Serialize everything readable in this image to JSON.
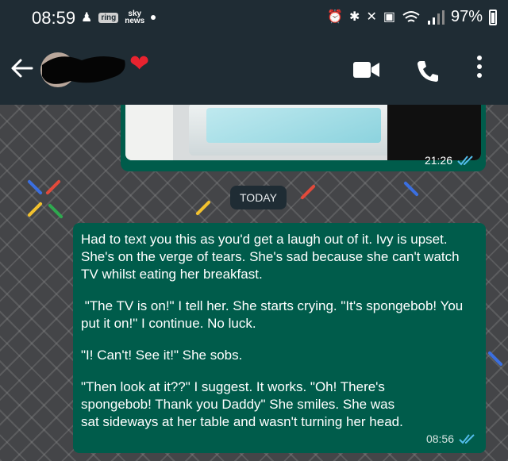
{
  "status_bar": {
    "time": "08:59",
    "ring_badge": "ring",
    "sky_top": "sky",
    "sky_bottom": "news",
    "battery": "97%"
  },
  "header": {
    "contact_name": "",
    "emoji": "❤",
    "heart_color": "#e8232f"
  },
  "chat": {
    "media_time": "21:26",
    "date_chip": "TODAY",
    "message_paragraphs": [
      "Had to text you this as you'd get a laugh out of it. Ivy is upset. She's on the verge of tears. She's sad because she can't watch TV whilst eating her breakfast.",
      " \"The TV is on!\" I tell her. She starts crying. \"It's spongebob! You put it on!\" I continue. No luck.",
      "\"I! Can't! See it!\" She sobs.",
      "\"Then look at it??\" I suggest. It works. \"Oh! There's spongebob! Thank you Daddy\" She smiles. She was sat sideways at her table and wasn't turning her head."
    ],
    "message_time": "08:56",
    "read_tick_color": "#53bdeb"
  },
  "colors": {
    "bar_bg": "#1f2c34",
    "outgoing_bubble": "#005c4b"
  },
  "icons": [
    "back-arrow-icon",
    "video-call-icon",
    "phone-icon",
    "more-options-icon",
    "double-check-icon"
  ]
}
